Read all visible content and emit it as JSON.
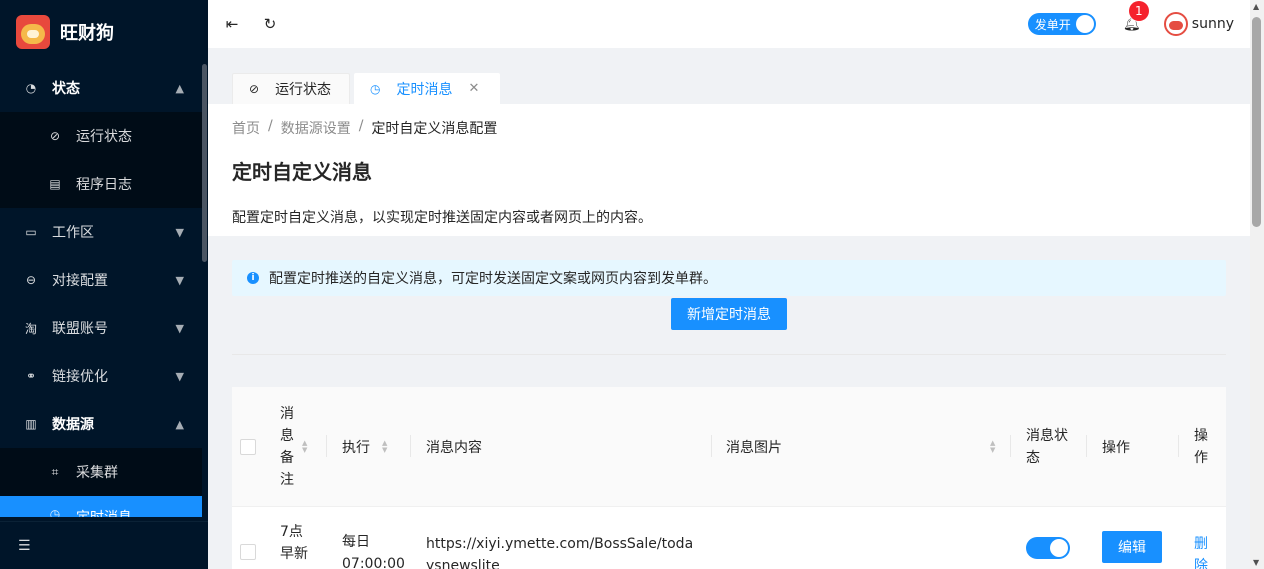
{
  "app": {
    "name": "旺财狗"
  },
  "sidebar": {
    "items": [
      {
        "label": "状态",
        "icon": "dashboard-icon",
        "open": true,
        "children": [
          {
            "label": "运行状态",
            "icon": "check-circle-icon"
          },
          {
            "label": "程序日志",
            "icon": "file-icon"
          }
        ]
      },
      {
        "label": "工作区",
        "icon": "desktop-icon"
      },
      {
        "label": "对接配置",
        "icon": "api-icon"
      },
      {
        "label": "联盟账号",
        "icon": "taobao-icon"
      },
      {
        "label": "链接优化",
        "icon": "link-icon"
      },
      {
        "label": "数据源",
        "icon": "database-icon",
        "open": true,
        "children": [
          {
            "label": "采集群",
            "icon": "scan-icon"
          },
          {
            "label": "定时消息",
            "icon": "clock-icon",
            "active": true
          }
        ]
      }
    ]
  },
  "header": {
    "switch_label": "发单开",
    "notification_count": "1",
    "username": "sunny"
  },
  "tabs": [
    {
      "label": "运行状态"
    },
    {
      "label": "定时消息",
      "active": true
    }
  ],
  "breadcrumb": [
    "首页",
    "数据源设置",
    "定时自定义消息配置"
  ],
  "page": {
    "title": "定时自定义消息",
    "description": "配置定时自定义消息，以实现定时推送固定内容或者网页上的内容。",
    "alert": "配置定时推送的自定义消息，可定时发送固定文案或网页内容到发单群。",
    "add_button": "新增定时消息"
  },
  "table": {
    "columns": [
      "消息备注",
      "执行",
      "消息内容",
      "消息图片",
      "消息状态",
      "操作",
      "操作"
    ],
    "rows": [
      {
        "note": "7点早新",
        "exec_day": "每日",
        "exec_time": "07:00:00",
        "content": "https://xiyi.ymette.com/BossSale/todaysnewslite",
        "status_on": true,
        "edit_label": "编辑",
        "delete_label": "删除"
      }
    ]
  },
  "colors": {
    "sidebar_bg": "#001529",
    "primary": "#1890ff",
    "badge": "#f5222d"
  }
}
